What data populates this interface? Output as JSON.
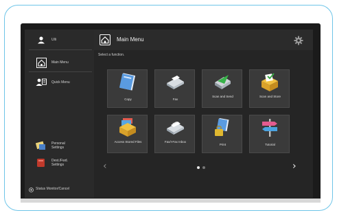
{
  "sidebar": {
    "user_label": "Ulli",
    "items": [
      {
        "label": "Main Menu",
        "icon": "home-icon"
      },
      {
        "label": "Quick Menu",
        "icon": "quick-menu-icon"
      }
    ],
    "bottom_items": [
      {
        "label": "Personal Settings",
        "icon": "personal-settings-icon"
      },
      {
        "label": "Dest./Fwd. Settings",
        "icon": "dest-fwd-settings-icon"
      }
    ],
    "status_label": "Status Monitor/Cancel"
  },
  "header": {
    "title": "Main Menu",
    "subtitle": "Select a function."
  },
  "tiles": [
    {
      "label": "Copy",
      "icon": "copy-icon"
    },
    {
      "label": "Fax",
      "icon": "fax-icon"
    },
    {
      "label": "Scan and Send",
      "icon": "scan-send-icon"
    },
    {
      "label": "Scan and Store",
      "icon": "scan-store-icon"
    },
    {
      "label": "Access Stored Files",
      "icon": "access-files-icon"
    },
    {
      "label": "Fax/I-Fax Inbox",
      "icon": "fax-inbox-icon"
    },
    {
      "label": "Print",
      "icon": "print-icon"
    },
    {
      "label": "Tutorial",
      "icon": "tutorial-icon"
    }
  ],
  "pagination": {
    "current": 1,
    "total": 2
  },
  "colors": {
    "frame": "#6cc4e8",
    "screen": "#2a2a2a",
    "tile": "#3a3a3a"
  }
}
